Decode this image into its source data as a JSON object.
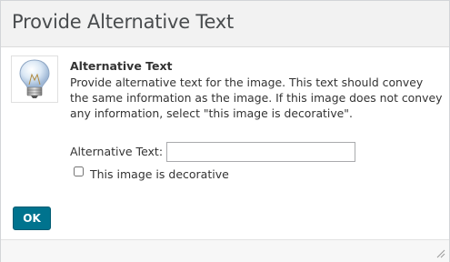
{
  "dialog": {
    "title": "Provide Alternative Text",
    "icon": "lightbulb-icon",
    "heading": "Alternative Text",
    "description": "Provide alternative text for the image. This text should convey the same information as the image. If this image does not convey any information, select \"this image is decorative\".",
    "alt_text_label": "Alternative Text:",
    "alt_text_value": "",
    "decorative_label": "This image is decorative",
    "decorative_checked": false,
    "ok_label": "OK",
    "accent_color": "#00738e"
  }
}
